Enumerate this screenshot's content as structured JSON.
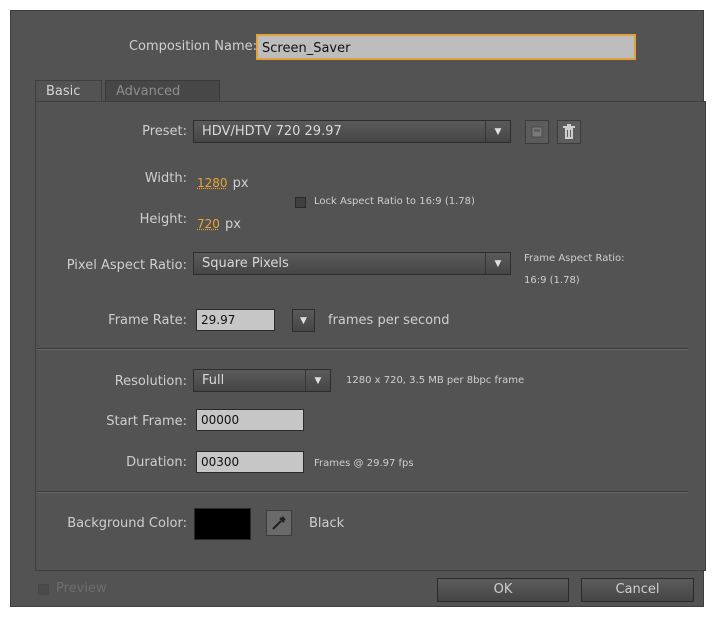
{
  "composition": {
    "name_label": "Composition Name:",
    "name_value": "Screen_Saver"
  },
  "tabs": [
    {
      "label": "Basic"
    },
    {
      "label": "Advanced"
    }
  ],
  "preset": {
    "label": "Preset:",
    "value": "HDV/HDTV 720 29.97"
  },
  "width": {
    "label": "Width:",
    "value": "1280",
    "unit": "px"
  },
  "height": {
    "label": "Height:",
    "value": "720",
    "unit": "px"
  },
  "lock_aspect": {
    "label": "Lock Aspect Ratio to 16:9 (1.78)",
    "checked": false
  },
  "pixel_aspect": {
    "label": "Pixel Aspect Ratio:",
    "value": "Square Pixels"
  },
  "frame_aspect": {
    "label": "Frame Aspect Ratio:",
    "value": "16:9 (1.78)"
  },
  "frame_rate": {
    "label": "Frame Rate:",
    "value": "29.97",
    "unit": "frames per second"
  },
  "resolution": {
    "label": "Resolution:",
    "value": "Full",
    "info": "1280 x 720, 3.5 MB per 8bpc frame"
  },
  "start_frame": {
    "label": "Start Frame:",
    "value": "00000"
  },
  "duration": {
    "label": "Duration:",
    "value": "00300",
    "info": "Frames @ 29.97 fps"
  },
  "background": {
    "label": "Background Color:",
    "color": "#000000",
    "name": "Black"
  },
  "preview": {
    "label": "Preview",
    "checked": false
  },
  "buttons": {
    "ok": "OK",
    "cancel": "Cancel"
  },
  "colors": {
    "dialog_bg": "#535353",
    "accent_orange": "#e8a534",
    "field_bg": "#c6c6c6"
  }
}
